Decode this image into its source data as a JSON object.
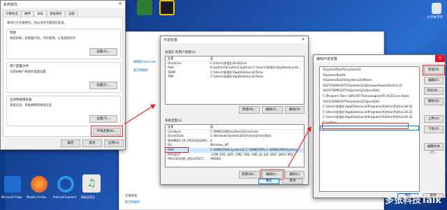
{
  "sysprops": {
    "title": "系统属性",
    "tabs": [
      "计算机名",
      "硬件",
      "高级",
      "系统保护",
      "远程"
    ],
    "admin_note": "要进行大多数更改，你必须作为管理员登录。",
    "perf": {
      "title": "性能",
      "desc": "视觉效果，处理器计划，内存使用，以及虚拟内存",
      "btn": "设置(S)..."
    },
    "profile": {
      "title": "用户配置文件",
      "desc": "与登录帐户相关的桌面设置",
      "btn": "设置(E)..."
    },
    "startup": {
      "title": "启动和故障恢复",
      "desc": "系统启动、系统故障和调试信息",
      "btn": "设置(T)..."
    },
    "env_btn": "环境变量(N)...",
    "ok": "确定",
    "cancel": "取消",
    "apply": "应用(A)"
  },
  "envvars": {
    "title": "环境变量",
    "user_group": "张强在 的用户变量(U)",
    "col_var": "变量",
    "col_val": "值",
    "user_rows": [
      {
        "name": "OneDrive",
        "value": "C:\\Users\\张强在\\OneDrive"
      },
      {
        "name": "Path",
        "value": "E:\\python\\Scripts\\;E:\\python\\;C:\\Users\\张强在\\AppData\\Local\\..."
      },
      {
        "name": "TEMP",
        "value": "C:\\Users\\张强在\\AppData\\Local\\Temp"
      },
      {
        "name": "TMP",
        "value": "C:\\Users\\张强在\\AppData\\Local\\Temp"
      }
    ],
    "user_new": "新建(N)...",
    "user_edit": "编辑(E)...",
    "user_del": "删除(D)",
    "sys_group": "系统变量(S)",
    "sys_rows": [
      {
        "name": "ComSpec",
        "value": "C:\\WINDOWS\\system32\\cmd.exe"
      },
      {
        "name": "DriverData",
        "value": "C:\\Windows\\System32\\Drivers\\DriverData"
      },
      {
        "name": "NUMBER_OF_PROCESSORS",
        "value": "4"
      },
      {
        "name": "OS",
        "value": "Windows_NT"
      },
      {
        "name": "Path",
        "value": "C:\\WINDOWS\\system32;C:\\WINDOWS;C:\\WINDOWS\\System..."
      },
      {
        "name": "PATHEXT",
        "value": ".COM;.EXE;.BAT;.CMD;.VBS;.VBE;.JS;.JSE;.WSF;.WSH;.MSC"
      },
      {
        "name": "PROCESSOR_ARCHITECT...",
        "value": "AMD64"
      }
    ],
    "sys_new": "新建(W)...",
    "sys_edit": "编辑(I)...",
    "sys_del": "删除(L)",
    "ok": "确定",
    "cancel": "取消"
  },
  "editenv": {
    "title": "编辑环境变量",
    "items": [
      "%SystemRoot%\\system32",
      "%SystemRoot%",
      "%SystemRoot%\\System32\\Wbem",
      "%SYSTEMROOT%\\System32\\WindowsPowerShell\\v1.0\\",
      "%SYSTEMROOT%\\System32\\OpenSSH\\",
      "C:\\Program Files (x86)\\ATI Technologies\\ATI.ACE\\Core-Static",
      "%SYSTEMROOT%\\System32\\OpenSSH\\",
      "C:\\Users\\张强在\\AppData\\Local\\Programs\\Python\\Python38-32",
      "C:\\Users\\张强在\\AppData\\Local\\Programs\\Python\\Python38-32",
      "C:\\Users\\张强在\\AppData\\Local\\Programs\\Python\\Python38-32",
      "E:\\python",
      ""
    ],
    "btn_new": "新建(N)",
    "btn_edit": "编辑(E)",
    "btn_browse": "浏览(B)...",
    "btn_delete": "删除(D)",
    "btn_up": "上移(U)",
    "btn_down": "下移(O)",
    "btn_text": "编辑文本(T)...",
    "ok": "确定",
    "cancel": "取消"
  },
  "behind": {
    "links": [
      "网络和 Internet",
      "安全和维护"
    ],
    "footer": [
      "另请参阅",
      "安全和维护"
    ]
  },
  "taskbar_icons": [
    {
      "label": "Microsoft Edge"
    },
    {
      "label": "Mozilla Firefox"
    },
    {
      "label": "Internet Explorer"
    },
    {
      "label": "网易云音乐"
    }
  ],
  "desktop": {
    "right_label": "大学本学年",
    "watermark": "多张科技Talk"
  },
  "colors": {
    "accent": "#0078d7",
    "highlight": "#e2231a",
    "desktop": "#1c4ea8"
  }
}
